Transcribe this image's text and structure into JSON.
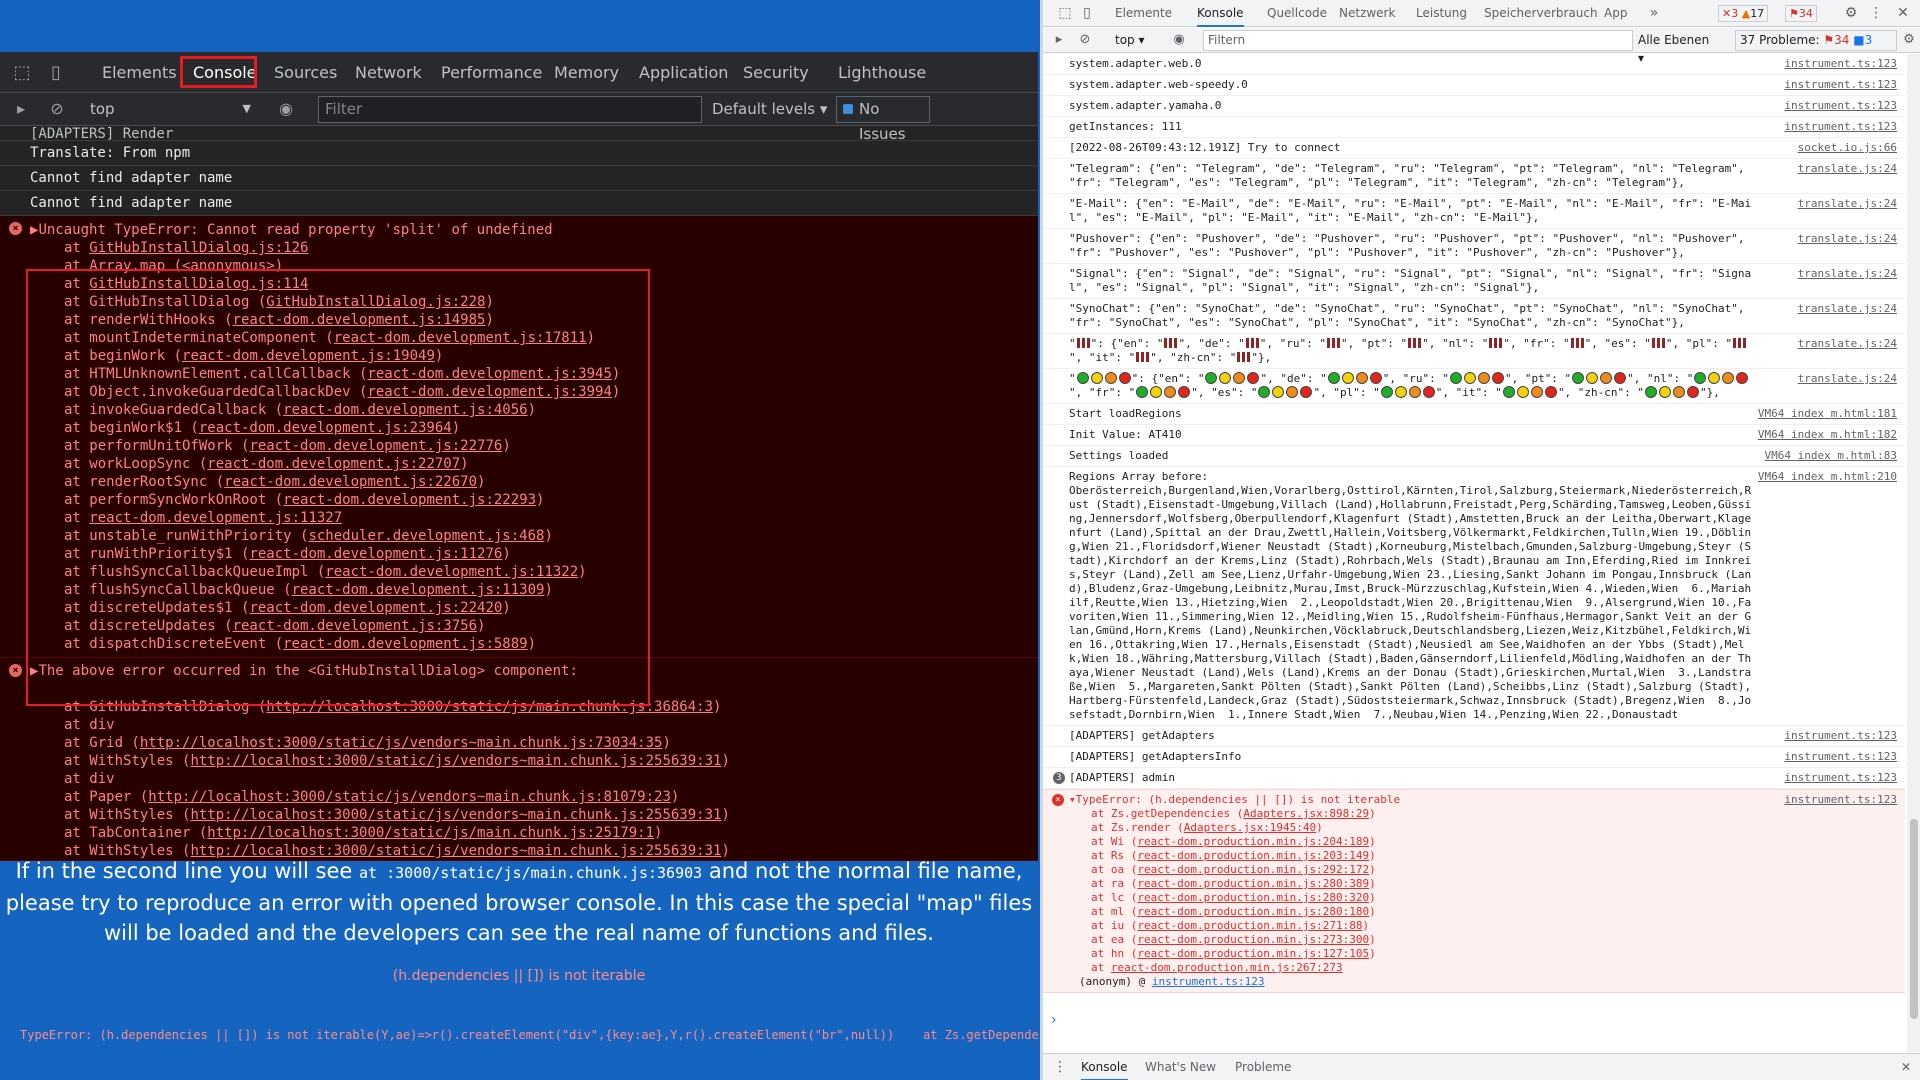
{
  "left": {
    "tabs": [
      "Elements",
      "Console",
      "Sources",
      "Network",
      "Performance",
      "Memory",
      "Application",
      "Security",
      "Lighthouse"
    ],
    "context": "top",
    "filter_placeholder": "Filter",
    "levels": "Default levels",
    "issues": "No Issues",
    "top_partial": "[ADAPTERS] Render",
    "info_rows": [
      "Translate: From npm",
      "Cannot find adapter name",
      "Cannot find adapter name"
    ],
    "error1": {
      "head": "Uncaught TypeError: Cannot read property 'split' of undefined",
      "frames": [
        [
          "at ",
          "GitHubInstallDialog.js:126",
          ""
        ],
        [
          "at Array.map (<anonymous>)",
          "",
          ""
        ],
        [
          "at ",
          "GitHubInstallDialog.js:114",
          ""
        ],
        [
          "at GitHubInstallDialog (",
          "GitHubInstallDialog.js:228",
          ")"
        ],
        [
          "at renderWithHooks (",
          "react-dom.development.js:14985",
          ")"
        ],
        [
          "at mountIndeterminateComponent (",
          "react-dom.development.js:17811",
          ")"
        ],
        [
          "at beginWork (",
          "react-dom.development.js:19049",
          ")"
        ],
        [
          "at HTMLUnknownElement.callCallback (",
          "react-dom.development.js:3945",
          ")"
        ],
        [
          "at Object.invokeGuardedCallbackDev (",
          "react-dom.development.js:3994",
          ")"
        ],
        [
          "at invokeGuardedCallback (",
          "react-dom.development.js:4056",
          ")"
        ],
        [
          "at beginWork$1 (",
          "react-dom.development.js:23964",
          ")"
        ],
        [
          "at performUnitOfWork (",
          "react-dom.development.js:22776",
          ")"
        ],
        [
          "at workLoopSync (",
          "react-dom.development.js:22707",
          ")"
        ],
        [
          "at renderRootSync (",
          "react-dom.development.js:22670",
          ")"
        ],
        [
          "at performSyncWorkOnRoot (",
          "react-dom.development.js:22293",
          ")"
        ],
        [
          "at ",
          "react-dom.development.js:11327",
          ""
        ],
        [
          "at unstable_runWithPriority (",
          "scheduler.development.js:468",
          ")"
        ],
        [
          "at runWithPriority$1 (",
          "react-dom.development.js:11276",
          ")"
        ],
        [
          "at flushSyncCallbackQueueImpl (",
          "react-dom.development.js:11322",
          ")"
        ],
        [
          "at flushSyncCallbackQueue (",
          "react-dom.development.js:11309",
          ")"
        ],
        [
          "at discreteUpdates$1 (",
          "react-dom.development.js:22420",
          ")"
        ],
        [
          "at discreteUpdates (",
          "react-dom.development.js:3756",
          ")"
        ],
        [
          "at dispatchDiscreteEvent (",
          "react-dom.development.js:5889",
          ")"
        ]
      ]
    },
    "error2": {
      "head": "The above error occurred in the <GitHubInstallDialog> component:",
      "frames": [
        [
          "at GitHubInstallDialog (",
          "http://localhost:3000/static/js/main.chunk.js:36864:3",
          ")"
        ],
        [
          "at div",
          "",
          ""
        ],
        [
          "at Grid (",
          "http://localhost:3000/static/js/vendors~main.chunk.js:73034:35",
          ")"
        ],
        [
          "at WithStyles (",
          "http://localhost:3000/static/js/vendors~main.chunk.js:255639:31",
          ")"
        ],
        [
          "at div",
          "",
          ""
        ],
        [
          "at Paper (",
          "http://localhost:3000/static/js/vendors~main.chunk.js:81079:23",
          ")"
        ],
        [
          "at WithStyles (",
          "http://localhost:3000/static/js/vendors~main.chunk.js:255639:31",
          ")"
        ],
        [
          "at TabContainer (",
          "http://localhost:3000/static/js/main.chunk.js:25179:1",
          ")"
        ],
        [
          "at WithStyles (",
          "http://localhost:3000/static/js/vendors~main.chunk.js:255639:31",
          ")"
        ]
      ]
    },
    "message": {
      "part1": "If in the second line you will see ",
      "code": "at :3000/static/js/main.chunk.js:36903",
      "part2": " and not the normal file name, please try to reproduce an error with opened browser console. In this case the special \"map\" files will be loaded and the developers can see the real name of functions and files."
    },
    "error_short": "(h.dependencies || []) is not iterable",
    "error_long": "TypeError: (h.dependencies || []) is not iterable(Y,ae)=>r().createElement(\"div\",{key:ae},Y,r().createElement(\"br\",null))    at Zs.getDependencies (http:/"
  },
  "right": {
    "tabs": [
      "Elemente",
      "Konsole",
      "Quellcode",
      "Netzwerk",
      "Leistung",
      "Speicherverbrauch",
      "App"
    ],
    "badges": {
      "errors": "3",
      "warnings": "17",
      "issues": "34"
    },
    "context": "top",
    "filter_placeholder": "Filtern",
    "levels": "Alle Ebenen",
    "problems": "37 Probleme:",
    "problems_err": "34",
    "problems_info": "3",
    "rows": [
      {
        "text": "system.adapter.web.0",
        "src": "instrument.ts:123"
      },
      {
        "text": "system.adapter.web-speedy.0",
        "src": "instrument.ts:123"
      },
      {
        "text": "system.adapter.yamaha.0",
        "src": "instrument.ts:123"
      },
      {
        "text": "getInstances: 111",
        "src": "instrument.ts:123"
      },
      {
        "text": "[2022-08-26T09:43:12.191Z] Try to connect",
        "src": "socket.io.js:66"
      },
      {
        "text": "\"Telegram\": {\"en\": \"Telegram\", \"de\": \"Telegram\", \"ru\": \"Telegram\", \"pt\": \"Telegram\", \"nl\": \"Telegram\", \"fr\": \"Telegram\", \"es\": \"Telegram\", \"pl\": \"Telegram\", \"it\": \"Telegram\", \"zh-cn\": \"Telegram\"},",
        "src": "translate.js:24"
      },
      {
        "text": "\"E-Mail\": {\"en\": \"E-Mail\", \"de\": \"E-Mail\", \"ru\": \"E-Mail\", \"pt\": \"E-Mail\", \"nl\": \"E-Mail\", \"fr\": \"E-Mail\", \"es\": \"E-Mail\", \"pl\": \"E-Mail\", \"it\": \"E-Mail\", \"zh-cn\": \"E-Mail\"},",
        "src": "translate.js:24"
      },
      {
        "text": "\"Pushover\": {\"en\": \"Pushover\", \"de\": \"Pushover\", \"ru\": \"Pushover\", \"pt\": \"Pushover\", \"nl\": \"Pushover\", \"fr\": \"Pushover\", \"es\": \"Pushover\", \"pl\": \"Pushover\", \"it\": \"Pushover\", \"zh-cn\": \"Pushover\"},",
        "src": "translate.js:24"
      },
      {
        "text": "\"Signal\": {\"en\": \"Signal\", \"de\": \"Signal\", \"ru\": \"Signal\", \"pt\": \"Signal\", \"nl\": \"Signal\", \"fr\": \"Signal\", \"es\": \"Signal\", \"pl\": \"Signal\", \"it\": \"Signal\", \"zh-cn\": \"Signal\"},",
        "src": "translate.js:24"
      },
      {
        "text": "\"SynoChat\": {\"en\": \"SynoChat\", \"de\": \"SynoChat\", \"ru\": \"SynoChat\", \"pt\": \"SynoChat\", \"nl\": \"SynoChat\", \"fr\": \"SynoChat\", \"es\": \"SynoChat\", \"pl\": \"SynoChat\", \"it\": \"SynoChat\", \"zh-cn\": \"SynoChat\"},",
        "src": "translate.js:24"
      }
    ],
    "bars_src": "translate.js:24",
    "dots_src": "translate.js:24",
    "rows2": [
      {
        "text": "Start loadRegions",
        "src": "VM64 index m.html:181"
      },
      {
        "text": "Init Value: AT410",
        "src": "VM64 index m.html:182"
      },
      {
        "text": "Settings loaded",
        "src": "VM64 index m.html:83"
      }
    ],
    "regions": {
      "text": "Regions Array before:\nOberösterreich,Burgenland,Wien,Vorarlberg,Osttirol,Kärnten,Tirol,Salzburg,Steiermark,Niederösterreich,Rust (Stadt),Eisenstadt-Umgebung,Villach (Land),Hollabrunn,Freistadt,Perg,Schärding,Tamsweg,Leoben,Güssing,Jennersdorf,Wolfsberg,Oberpullendorf,Klagenfurt (Stadt),Amstetten,Bruck an der Leitha,Oberwart,Klagenfurt (Land),Spittal an der Drau,Zwettl,Hallein,Voitsberg,Völkermarkt,Feldkirchen,Tulln,Wien 19.,Döbling,Wien 21.,Floridsdorf,Wiener Neustadt (Stadt),Korneuburg,Mistelbach,Gmunden,Salzburg-Umgebung,Steyr (Stadt),Kirchdorf an der Krems,Linz (Stadt),Rohrbach,Wels (Stadt),Braunau am Inn,Eferding,Ried im Innkreis,Steyr (Land),Zell am See,Lienz,Urfahr-Umgebung,Wien 23.,Liesing,Sankt Johann im Pongau,Innsbruck (Land),Bludenz,Graz-Umgebung,Leibnitz,Murau,Imst,Bruck-Mürzzuschlag,Kufstein,Wien 4.,Wieden,Wien  6.,Mariahilf,Reutte,Wien 13.,Hietzing,Wien  2.,Leopoldstadt,Wien 20.,Brigittenau,Wien  9.,Alsergrund,Wien 10.,Favoriten,Wien 11.,Simmering,Wien 12.,Meidling,Wien 15.,Rudolfsheim-Fünfhaus,Hermagor,Sankt Veit an der Glan,Gmünd,Horn,Krems (Land),Neunkirchen,Vöcklabruck,Deutschlandsberg,Liezen,Weiz,Kitzbühel,Feldkirch,Wien 16.,Ottakring,Wien 17.,Hernals,Eisenstadt (Stadt),Neusiedl am See,Waidhofen an der Ybbs (Stadt),Melk,Wien 18.,Währing,Mattersburg,Villach (Stadt),Baden,Gänserndorf,Lilienfeld,Mödling,Waidhofen an der Thaya,Wiener Neustadt (Land),Wels (Land),Krems an der Donau (Stadt),Grieskirchen,Murtal,Wien  3.,Landstraße,Wien  5.,Margareten,Sankt Pölten (Stadt),Sankt Pölten (Land),Scheibbs,Linz (Stadt),Salzburg (Stadt),Hartberg-Fürstenfeld,Landeck,Graz (Stadt),Südoststeiermark,Schwaz,Innsbruck (Stadt),Bregenz,Wien  8.,Josefstadt,Dornbirn,Wien  1.,Innere Stadt,Wien  7.,Neubau,Wien 14.,Penzing,Wien 22.,Donaustadt",
      "src": "VM64 index m.html:210"
    },
    "rows3": [
      {
        "text": "[ADAPTERS] getAdapters",
        "src": "instrument.ts:123"
      },
      {
        "text": "[ADAPTERS] getAdaptersInfo",
        "src": "instrument.ts:123"
      }
    ],
    "admin_row": {
      "count": "3",
      "text": "[ADAPTERS] admin",
      "src": "instrument.ts:123"
    },
    "error": {
      "head": "TypeError: (h.dependencies || []) is not iterable",
      "src": "instrument.ts:123",
      "frames": [
        [
          "at Zs.getDependencies (",
          "Adapters.jsx:898:29",
          ")"
        ],
        [
          "at Zs.render (",
          "Adapters.jsx:1945:40",
          ")"
        ],
        [
          "at Wi (",
          "react-dom.production.min.js:204:189",
          ")"
        ],
        [
          "at Rs (",
          "react-dom.production.min.js:203:149",
          ")"
        ],
        [
          "at oa (",
          "react-dom.production.min.js:292:172",
          ")"
        ],
        [
          "at ra (",
          "react-dom.production.min.js:280:389",
          ")"
        ],
        [
          "at lc (",
          "react-dom.production.min.js:280:320",
          ")"
        ],
        [
          "at ml (",
          "react-dom.production.min.js:280:180",
          ")"
        ],
        [
          "at iu (",
          "react-dom.production.min.js:271:88",
          ")"
        ],
        [
          "at ea (",
          "react-dom.production.min.js:273:300",
          ")"
        ],
        [
          "at hn (",
          "react-dom.production.min.js:127:105",
          ")"
        ],
        [
          "at ",
          "react-dom.production.min.js:267:273",
          ""
        ]
      ],
      "anon_label": "(anonym) @ ",
      "anon_link": "instrument.ts:123"
    },
    "bottom_tabs": [
      "Konsole",
      "What's New",
      "Probleme"
    ]
  }
}
